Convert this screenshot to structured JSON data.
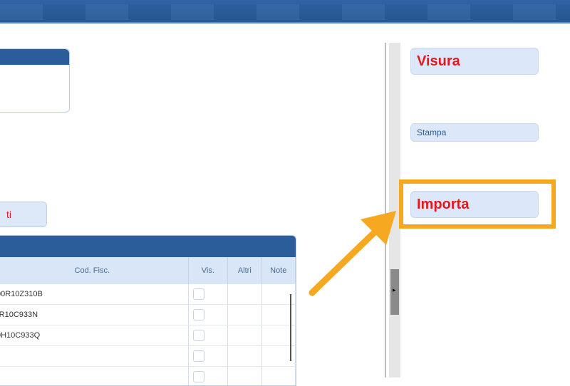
{
  "left_panel": {
    "red_button_label": "ti",
    "grid": {
      "columns": [
        "Cod. Fisc.",
        "Vis.",
        "Altri",
        "Note"
      ],
      "rows": [
        {
          "cod": "00R10Z310B"
        },
        {
          "cod": ")R10C933N"
        },
        {
          "cod": "0H10C933Q"
        },
        {
          "cod": ""
        },
        {
          "cod": ""
        }
      ]
    }
  },
  "right_panel": {
    "visura_label": "Visura",
    "stampa_label": "Stampa",
    "importa_label": "Importa"
  },
  "annotation": {
    "highlight_color": "#f6a821",
    "arrow_color": "#f6a821",
    "target": "Importa"
  },
  "colors": {
    "header_blue": "#2b5d9b",
    "button_bg": "#dce8fa",
    "accent_red": "#e3191e"
  }
}
